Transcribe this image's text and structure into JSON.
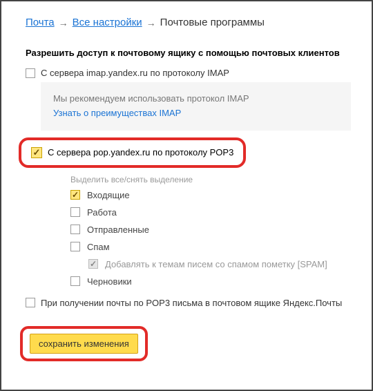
{
  "breadcrumb": {
    "mail": "Почта",
    "settings": "Все настройки",
    "current": "Почтовые программы"
  },
  "header": "Разрешить доступ к почтовому ящику с помощью почтовых клиентов",
  "imap": {
    "label": "С сервера imap.yandex.ru по протоколу IMAP",
    "info_text": "Мы рекомендуем использовать протокол IMAP",
    "info_link": "Узнать о преимуществах IMAP"
  },
  "pop3": {
    "label": "С сервера pop.yandex.ru по протоколу POP3",
    "toggle_all": "Выделить все/снять выделение",
    "folders": {
      "inbox": "Входящие",
      "work": "Работа",
      "sent": "Отправленные",
      "spam": "Спам",
      "spam_tag": "Добавлять к темам писем со спамом пометку [SPAM]",
      "drafts": "Черновики"
    }
  },
  "archive_label": "При получении почты по POP3 письма в почтовом ящике Яндекс.Почты",
  "save_button": "сохранить изменения"
}
